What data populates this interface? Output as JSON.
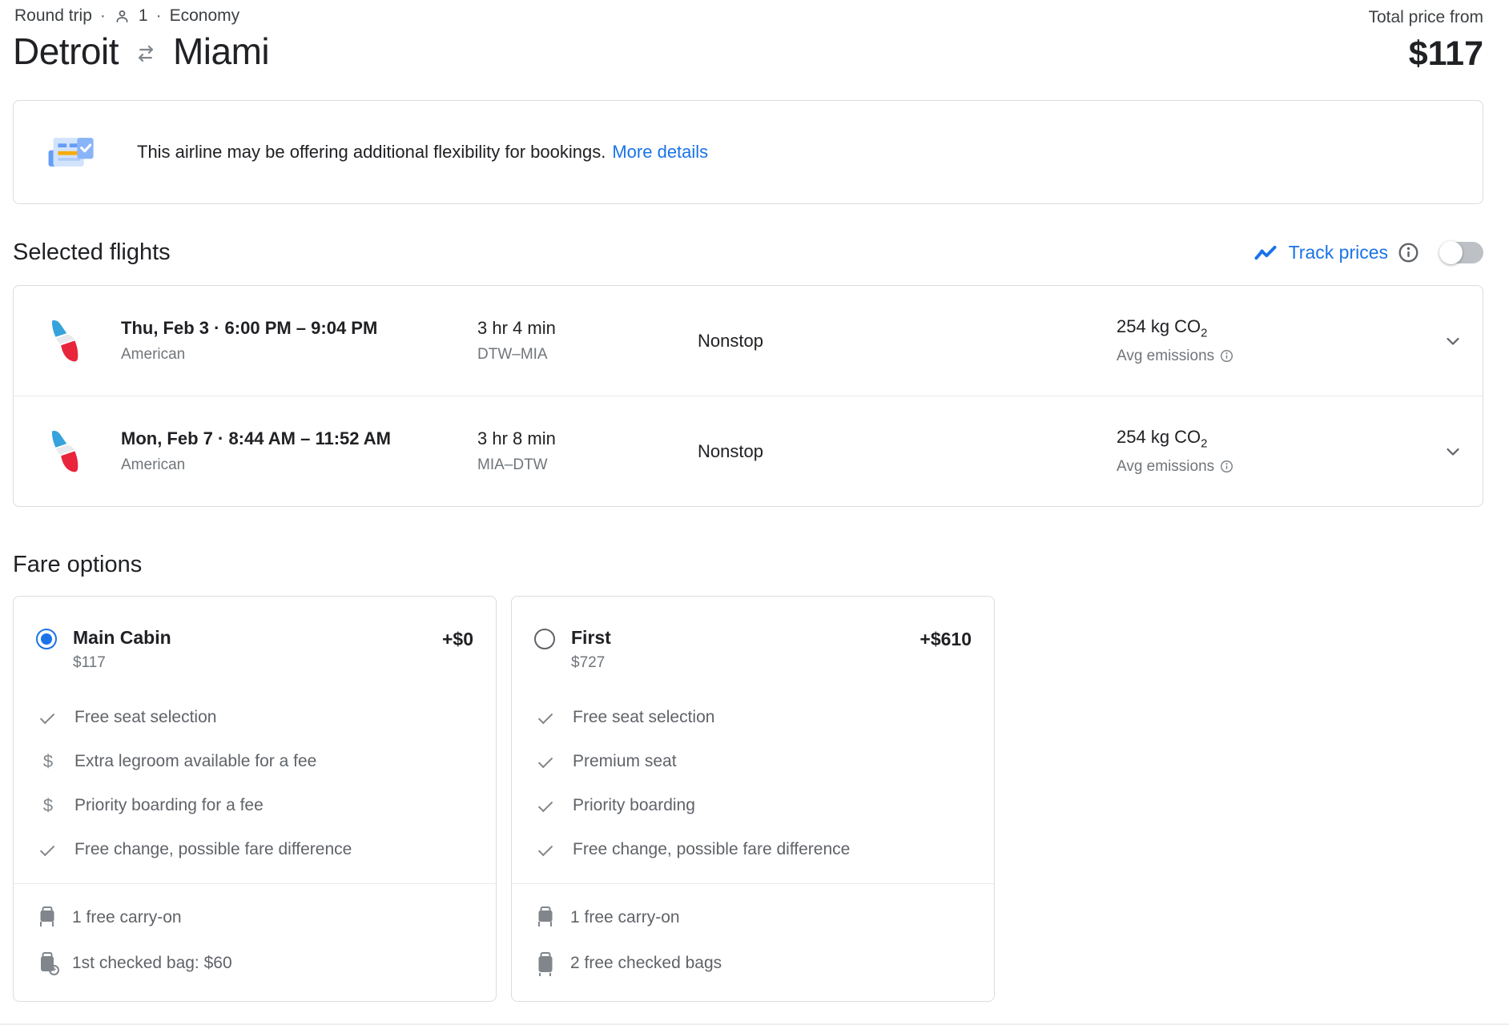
{
  "header": {
    "trip_type": "Round trip",
    "separator": "·",
    "passenger_count": "1",
    "cabin_class": "Economy",
    "origin": "Detroit",
    "destination": "Miami",
    "total_price_label": "Total price from",
    "total_price": "$117"
  },
  "banner": {
    "message": "This airline may be offering additional flexibility for bookings.",
    "link_label": "More details"
  },
  "selected_flights": {
    "title": "Selected flights",
    "track_prices_label": "Track prices",
    "track_prices_enabled": false,
    "flights": [
      {
        "airline": "American",
        "schedule": "Thu, Feb 3 · 6:00 PM – 9:04 PM",
        "duration": "3 hr 4 min",
        "route": "DTW–MIA",
        "stops": "Nonstop",
        "emissions": "254 kg CO",
        "emissions_subscript": "2",
        "emissions_note": "Avg emissions"
      },
      {
        "airline": "American",
        "schedule": "Mon, Feb 7 · 8:44 AM – 11:52 AM",
        "duration": "3 hr 8 min",
        "route": "MIA–DTW",
        "stops": "Nonstop",
        "emissions": "254 kg CO",
        "emissions_subscript": "2",
        "emissions_note": "Avg emissions"
      }
    ]
  },
  "fare_options": {
    "title": "Fare options",
    "cards": [
      {
        "name": "Main Cabin",
        "price": "$117",
        "price_delta": "+$0",
        "radio": "radio-selected",
        "features": [
          {
            "icon": "check",
            "text": "Free seat selection"
          },
          {
            "icon": "dollar",
            "text": "Extra legroom available for a fee"
          },
          {
            "icon": "dollar",
            "text": "Priority boarding for a fee"
          },
          {
            "icon": "check",
            "text": "Free change, possible fare difference"
          }
        ],
        "baggage": [
          {
            "icon": "carry-on-bag",
            "text": "1 free carry-on"
          },
          {
            "icon": "checked-bag-add",
            "text": "1st checked bag: $60"
          }
        ]
      },
      {
        "name": "First",
        "price": "$727",
        "price_delta": "+$610",
        "radio": "radio-unselected",
        "features": [
          {
            "icon": "check",
            "text": "Free seat selection"
          },
          {
            "icon": "check",
            "text": "Premium seat"
          },
          {
            "icon": "check",
            "text": "Priority boarding"
          },
          {
            "icon": "check",
            "text": "Free change, possible fare difference"
          }
        ],
        "baggage": [
          {
            "icon": "carry-on-bag",
            "text": "1 free carry-on"
          },
          {
            "icon": "checked-bag",
            "text": "2 free checked bags"
          }
        ]
      }
    ]
  },
  "colors": {
    "accent_blue": "#1a73e8",
    "text_primary": "#202124",
    "text_secondary": "#5f6368",
    "border_gray": "#dadce0",
    "banner_line_orange": "#f9ab00",
    "airline_logo_blue": "#36a3dc",
    "airline_logo_red": "#e8253b"
  }
}
